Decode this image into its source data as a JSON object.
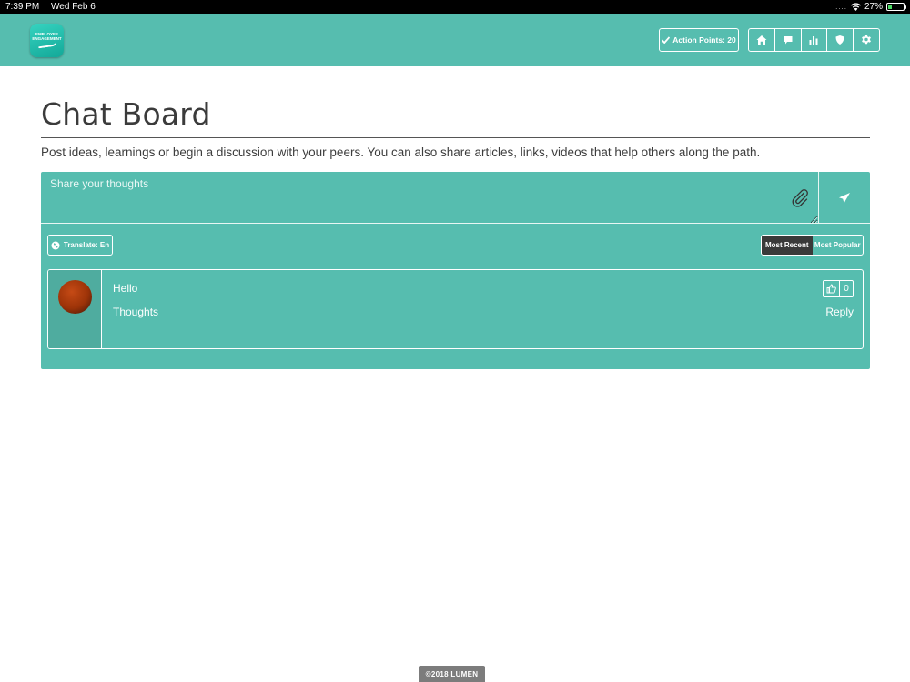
{
  "status_bar": {
    "time": "7:39 PM",
    "date": "Wed Feb 6",
    "battery": "27%",
    "battery_level": 0.27
  },
  "header": {
    "logo_text_line1": "EMPLOYEE",
    "logo_text_line2": "ENGAGEMENT",
    "action_points_label": "Action Points: 20",
    "nav_icons": [
      "home-icon",
      "chat-icon",
      "bar-chart-icon",
      "shield-icon",
      "gear-icon"
    ]
  },
  "main": {
    "title": "Chat Board",
    "description": "Post ideas, learnings or begin a discussion with your peers. You can also share articles, links, videos that help others along the path.",
    "composer": {
      "placeholder": "Share your thoughts"
    },
    "translate_label": "Translate: En",
    "sort": {
      "most_recent": "Most Recent",
      "most_popular": "Most Popular",
      "selected": "Most Recent"
    },
    "posts": [
      {
        "title": "Hello",
        "body": "Thoughts",
        "likes": "0",
        "reply_label": "Reply"
      }
    ]
  },
  "footer": {
    "copyright": "©2018 LUMEN"
  },
  "colors": {
    "brand_teal": "#56bdaf",
    "active_dark": "#3a3a3a"
  }
}
